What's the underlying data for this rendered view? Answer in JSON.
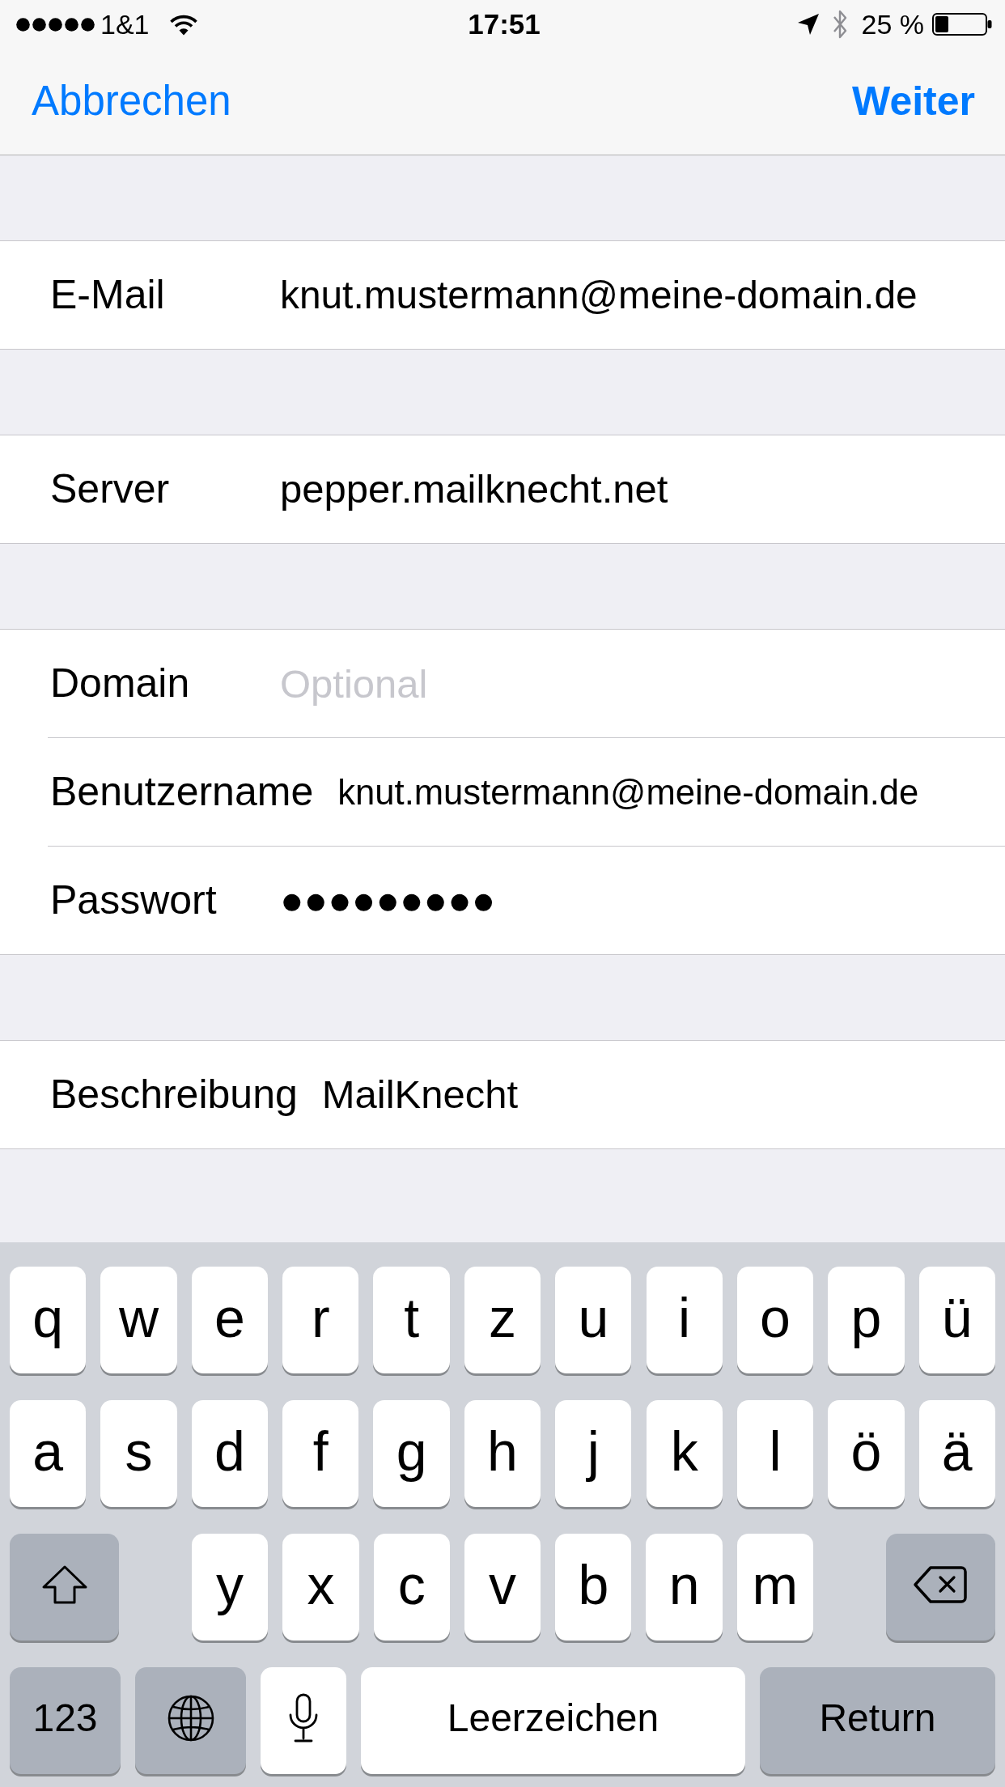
{
  "status_bar": {
    "carrier": "1&1",
    "time": "17:51",
    "battery": "25 %"
  },
  "nav_bar": {
    "cancel_button": "Abbrechen",
    "next_button": "Weiter"
  },
  "sections": [
    {
      "rows": [
        {
          "label": "E-Mail",
          "value": "knut.mustermann@meine-domain.de"
        }
      ]
    },
    {
      "rows": [
        {
          "label": "Server",
          "value": "pepper.mailknecht.net"
        }
      ]
    },
    {
      "rows": [
        {
          "label": "Domain",
          "placeholder": "Optional"
        },
        {
          "label": "Benutzername",
          "value": "knut.mustermann@meine-domain.de"
        },
        {
          "label": "Passwort",
          "value": "●●●●●●●●●"
        }
      ]
    },
    {
      "rows": [
        {
          "label": "Beschreibung",
          "value": "MailKnecht"
        }
      ]
    }
  ],
  "keyboard": {
    "rows": [
      {
        "keys": [
          {
            "kind": "letter",
            "label": "q"
          },
          {
            "kind": "letter",
            "label": "w"
          },
          {
            "kind": "letter",
            "label": "e"
          },
          {
            "kind": "letter",
            "label": "r"
          },
          {
            "kind": "letter",
            "label": "t"
          },
          {
            "kind": "letter",
            "label": "z"
          },
          {
            "kind": "letter",
            "label": "u"
          },
          {
            "kind": "letter",
            "label": "i"
          },
          {
            "kind": "letter",
            "label": "o"
          },
          {
            "kind": "letter",
            "label": "p"
          },
          {
            "kind": "letter",
            "label": "ü"
          }
        ]
      },
      {
        "keys": [
          {
            "kind": "letter",
            "label": "a"
          },
          {
            "kind": "letter",
            "label": "s"
          },
          {
            "kind": "letter",
            "label": "d"
          },
          {
            "kind": "letter",
            "label": "f"
          },
          {
            "kind": "letter",
            "label": "g"
          },
          {
            "kind": "letter",
            "label": "h"
          },
          {
            "kind": "letter",
            "label": "j"
          },
          {
            "kind": "letter",
            "label": "k"
          },
          {
            "kind": "letter",
            "label": "l"
          },
          {
            "kind": "letter",
            "label": "ö"
          },
          {
            "kind": "letter",
            "label": "ä"
          }
        ]
      },
      {
        "keys": [
          {
            "kind": "shift"
          },
          {
            "kind": "letter",
            "label": "y"
          },
          {
            "kind": "letter",
            "label": "x"
          },
          {
            "kind": "letter",
            "label": "c"
          },
          {
            "kind": "letter",
            "label": "v"
          },
          {
            "kind": "letter",
            "label": "b"
          },
          {
            "kind": "letter",
            "label": "n"
          },
          {
            "kind": "letter",
            "label": "m"
          },
          {
            "kind": "backspace"
          }
        ]
      },
      {
        "keys": [
          {
            "kind": "numbers",
            "label": "123"
          },
          {
            "kind": "globe"
          },
          {
            "kind": "mic"
          },
          {
            "kind": "space",
            "label": "Leerzeichen"
          },
          {
            "kind": "return",
            "label": "Return"
          }
        ]
      }
    ]
  }
}
